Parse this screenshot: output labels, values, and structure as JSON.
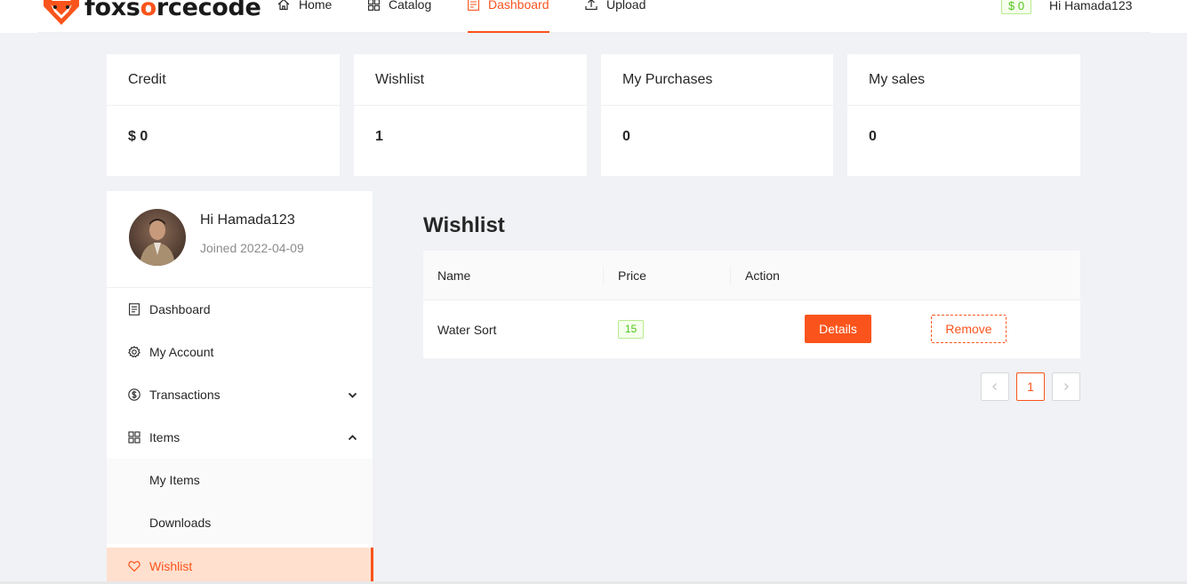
{
  "brand": {
    "logo_text_prefix": "foxs",
    "logo_text_o": "o",
    "logo_text_suffix": "rcecode",
    "accent": "#fa541c"
  },
  "nav": {
    "home": "Home",
    "catalog": "Catalog",
    "dashboard": "Dashboard",
    "upload": "Upload",
    "active": "Dashboard"
  },
  "header": {
    "credit_badge": "$ 0",
    "greeting": "Hi Hamada123"
  },
  "stats": [
    {
      "title": "Credit",
      "value": "$ 0"
    },
    {
      "title": "Wishlist",
      "value": "1"
    },
    {
      "title": "My Purchases",
      "value": "0"
    },
    {
      "title": "My sales",
      "value": "0"
    }
  ],
  "profile": {
    "greeting": "Hi Hamada123",
    "joined": "Joined 2022-04-09"
  },
  "sidebar": {
    "items": [
      {
        "label": "Dashboard",
        "icon": "document-icon"
      },
      {
        "label": "My Account",
        "icon": "gear-icon"
      },
      {
        "label": "Transactions",
        "icon": "dollar-circle-icon",
        "expanded": false
      },
      {
        "label": "Items",
        "icon": "grid-icon",
        "expanded": true
      },
      {
        "label": "My Items"
      },
      {
        "label": "Downloads"
      },
      {
        "label": "Wishlist",
        "icon": "heart-icon",
        "selected": true
      }
    ]
  },
  "wishlist": {
    "title": "Wishlist",
    "columns": [
      "Name",
      "Price",
      "Action"
    ],
    "rows": [
      {
        "name": "Water Sort",
        "price": "15",
        "details_label": "Details",
        "remove_label": "Remove"
      }
    ]
  },
  "pagination": {
    "current": "1"
  }
}
